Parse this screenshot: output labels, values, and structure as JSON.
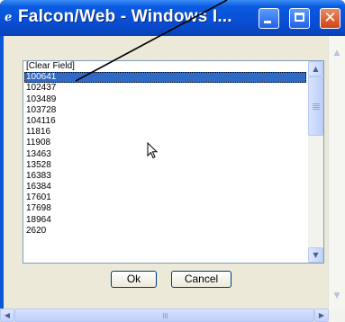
{
  "window": {
    "title": "Falcon/Web - Windows I...",
    "minimize_icon": "minimize-icon",
    "maximize_icon": "maximize-icon",
    "close_icon": "close-icon"
  },
  "list": {
    "items": [
      "[Clear Field]",
      "100641",
      "102437",
      "103489",
      "103728",
      "104116",
      "11816",
      "11908",
      "13463",
      "13528",
      "16383",
      "16384",
      "17601",
      "17698",
      "18964",
      "2620"
    ],
    "selected": "100641"
  },
  "buttons": {
    "ok": "Ok",
    "cancel": "Cancel"
  },
  "colors": {
    "titlebar": "#0a4fd6",
    "selection": "#316ac5",
    "close": "#d04414"
  }
}
